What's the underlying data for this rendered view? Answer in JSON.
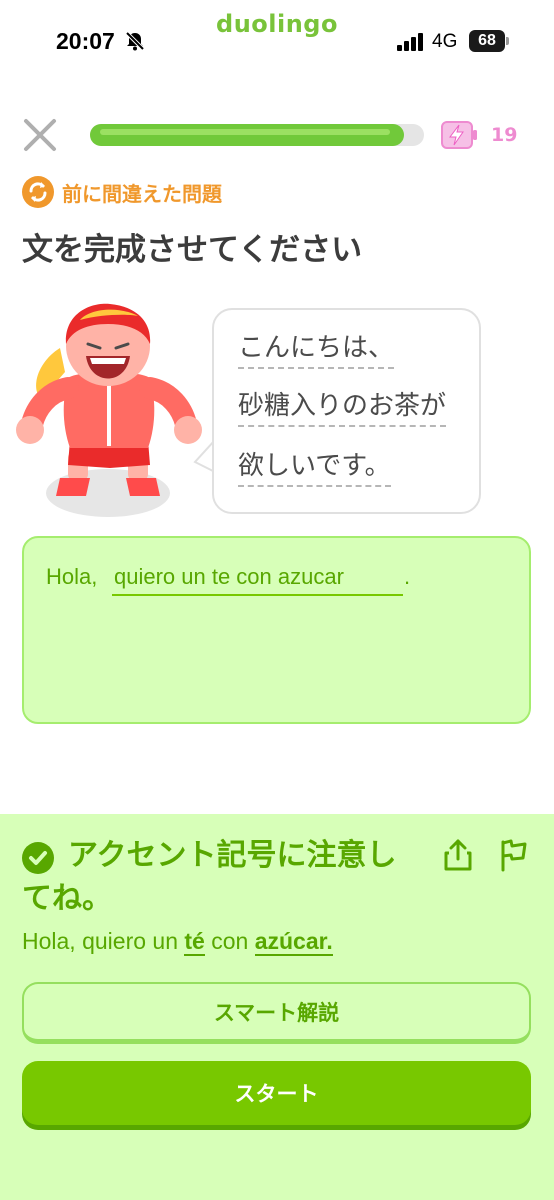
{
  "status_bar": {
    "time": "20:07",
    "app_logo": "duolingo",
    "network": "4G",
    "battery": "68",
    "icons": [
      "bell-slash-icon",
      "signal-icon",
      "battery-icon"
    ]
  },
  "lesson": {
    "progress_percent": 94,
    "energy_count": "19",
    "review_label": "前に間違えた問題",
    "title": "文を完成させてください"
  },
  "prompt": {
    "bubble_lines": [
      "こんにちは、",
      "砂糖入りのお茶が",
      "欲しいです。"
    ]
  },
  "answer": {
    "prefix": "Hola,",
    "value": "quiero un te con azucar",
    "suffix": "."
  },
  "feedback": {
    "title": "アクセント記号に注意してね。",
    "correction_parts": [
      "Hola, quiero un ",
      "té",
      " con ",
      "azúcar."
    ],
    "explain_button": "スマート解説",
    "start_button": "スタート"
  },
  "colors": {
    "brand_green": "#58a700",
    "button_green": "#78c800",
    "panel_bg": "#d7ffb8",
    "review_orange": "#f0982c",
    "energy_pink": "#ee8bd0"
  }
}
